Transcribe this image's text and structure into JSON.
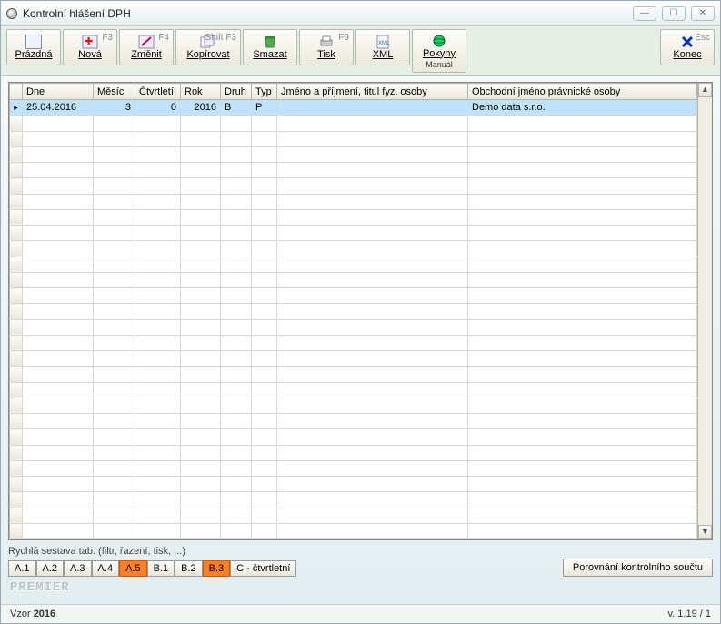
{
  "window": {
    "title": "Kontrolní hlášení DPH"
  },
  "toolbar": {
    "blank": {
      "label": "Prázdná"
    },
    "new": {
      "label": "Nová",
      "shortcut": "F3"
    },
    "edit": {
      "label": "Změnit",
      "shortcut": "F4"
    },
    "copy": {
      "label": "Kopírovat",
      "shortcut": "Shift F3"
    },
    "delete": {
      "label": "Smazat"
    },
    "print": {
      "label": "Tisk",
      "shortcut": "F9"
    },
    "xml": {
      "label": "XML"
    },
    "guide": {
      "label": "Pokyny",
      "manual": "Manuál"
    },
    "close": {
      "label": "Konec",
      "shortcut": "Esc"
    }
  },
  "grid": {
    "columns": [
      "Dne",
      "Měsíc",
      "Čtvrtletí",
      "Rok",
      "Druh",
      "Typ",
      "Jméno a příjmení, titul fyz. osoby",
      "Obchodní jméno právnické osoby"
    ],
    "rows": [
      {
        "dne": "25.04.2016",
        "mesic": "3",
        "ctvrtleti": "0",
        "rok": "2016",
        "druh": "B",
        "typ": "P",
        "jmeno": "",
        "obchodni": "Demo data s.r.o."
      }
    ]
  },
  "quick": {
    "label": "Rychlá sestava tab. (filtr, řazení, tisk, ...)",
    "tabs": [
      {
        "label": "A.1",
        "orange": false
      },
      {
        "label": "A.2",
        "orange": false
      },
      {
        "label": "A.3",
        "orange": false
      },
      {
        "label": "A.4",
        "orange": false
      },
      {
        "label": "A.5",
        "orange": true
      },
      {
        "label": "B.1",
        "orange": false
      },
      {
        "label": "B.2",
        "orange": false
      },
      {
        "label": "B.3",
        "orange": true
      },
      {
        "label": "C - čtvrtletní",
        "orange": false
      }
    ],
    "compare": "Porovnání kontrolního součtu"
  },
  "footer": {
    "logo": "PREMIER",
    "vzor_label": "Vzor",
    "vzor_value": "2016",
    "version": "v. 1.19 / 1"
  }
}
